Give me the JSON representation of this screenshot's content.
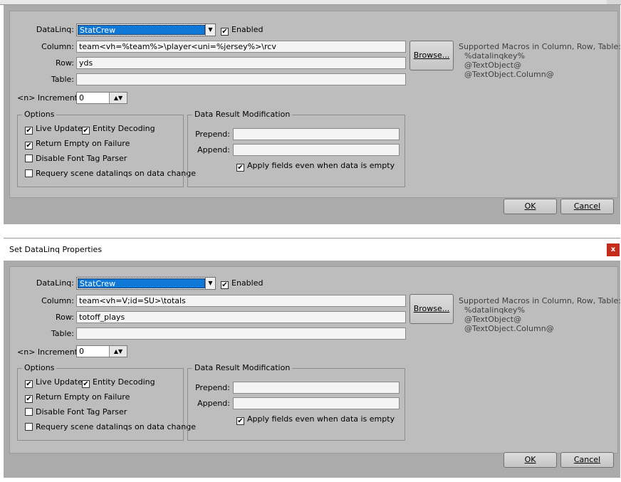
{
  "dialog_title": "Set DataLinq Properties",
  "close_label": "x",
  "labels": {
    "datalinq": "DataLinq:",
    "column": "Column:",
    "row": "Row:",
    "table": "Table:",
    "increment": "<n> Increment:",
    "enabled": "Enabled",
    "browse": "Browse...",
    "options": "Options",
    "live_update": "Live Update",
    "entity_decoding": "Entity Decoding",
    "return_empty": "Return Empty on Failure",
    "disable_font_tag": "Disable Font Tag Parser",
    "requery": "Requery scene datalinqs on data change",
    "drm": "Data Result Modification",
    "prepend": "Prepend:",
    "append": "Append:",
    "apply_fields": "Apply fields even when data is empty",
    "ok": "OK",
    "cancel": "Cancel"
  },
  "macros": {
    "heading": "Supported Macros in Column, Row, Table:",
    "items": [
      "%datalinqkey%",
      "@TextObject@",
      "@TextObject.Column@"
    ]
  },
  "dialogs": [
    {
      "datalinq": "StatCrew",
      "enabled": true,
      "column": "team<vh=%team%>\\player<uni=%jersey%>\\rcv",
      "row": "yds",
      "table": "",
      "increment": "0",
      "live_update": true,
      "entity_decoding": true,
      "return_empty": true,
      "disable_font_tag": false,
      "requery": false,
      "prepend": "",
      "append": "",
      "apply_fields": true
    },
    {
      "datalinq": "StatCrew",
      "enabled": true,
      "column": "team<vh=V;id=SU>\\totals",
      "row": "totoff_plays",
      "table": "",
      "increment": "0",
      "live_update": true,
      "entity_decoding": true,
      "return_empty": true,
      "disable_font_tag": false,
      "requery": false,
      "prepend": "",
      "append": "",
      "apply_fields": true
    }
  ]
}
